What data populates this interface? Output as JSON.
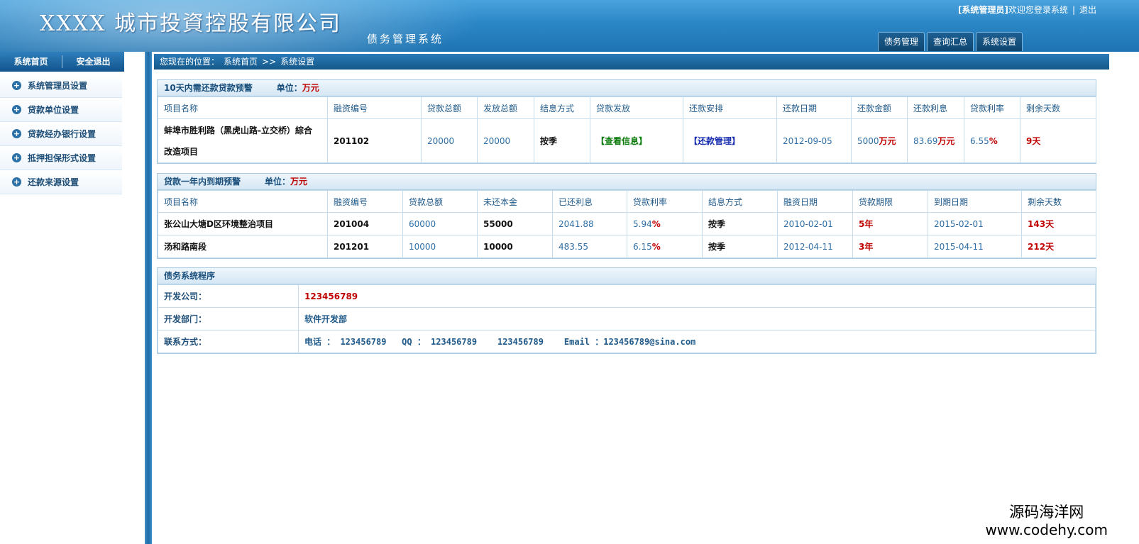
{
  "header": {
    "title": "XXXX 城市投資控股有限公司",
    "subtitle": "债务管理系统",
    "user_role": "[系统管理员]",
    "welcome": "欢迎您登录系统",
    "separator": "|",
    "logout": "退出",
    "tabs": [
      "债务管理",
      "查询汇总",
      "系统设置"
    ]
  },
  "sidebar": {
    "top_buttons": [
      "系统首页",
      "安全退出"
    ],
    "items": [
      {
        "label": "系统管理员设置",
        "icon": "plus-circle-icon"
      },
      {
        "label": "贷款单位设置",
        "icon": "plus-circle-icon"
      },
      {
        "label": "贷款经办银行设置",
        "icon": "plus-circle-icon"
      },
      {
        "label": "抵押担保形式设置",
        "icon": "plus-circle-icon"
      },
      {
        "label": "还款来源设置",
        "icon": "plus-circle-icon"
      }
    ]
  },
  "breadcrumb": {
    "prefix": "您现在的位置：",
    "home": "系统首页",
    "arrow": ">>",
    "current": "系统设置"
  },
  "panel1": {
    "title": "10天内需还款贷款预警",
    "unit_label": "单位：",
    "unit_value": "万元",
    "columns": [
      "项目名称",
      "融资编号",
      "贷款总额",
      "发放总额",
      "结息方式",
      "贷款发放",
      "还款安排",
      "还款日期",
      "还款金额",
      "还款利息",
      "贷款利率",
      "剩余天数"
    ],
    "rows": [
      {
        "name_line1": "蚌埠市胜利路（黑虎山路-立交桥）綜合",
        "name_line2": "改造项目",
        "code": "201102",
        "total": "20000",
        "issued": "20000",
        "interest_method": "按季",
        "issue_link": "【查看信息】",
        "repay_link": "【还款管理】",
        "repay_date": "2012-09-05",
        "repay_amount_num": "5000",
        "repay_amount_unit": "万元",
        "interest_num": "83.69",
        "interest_unit": "万元",
        "rate_num": "6.55",
        "rate_unit": "%",
        "days_num": "9",
        "days_unit": "天"
      }
    ]
  },
  "panel2": {
    "title": "贷款一年内到期预警",
    "unit_label": "单位：",
    "unit_value": "万元",
    "columns": [
      "项目名称",
      "融资编号",
      "贷款总额",
      "未还本金",
      "已还利息",
      "贷款利率",
      "结息方式",
      "融资日期",
      "贷款期限",
      "到期日期",
      "剩余天数"
    ],
    "rows": [
      {
        "name": "张公山大塘D区环境整治项目",
        "code": "201004",
        "total": "60000",
        "principal": "55000",
        "interest": "2041.88",
        "rate_num": "5.94",
        "rate_unit": "%",
        "method": "按季",
        "date": "2010-02-01",
        "term_num": "5",
        "term_unit": "年",
        "due": "2015-02-01",
        "days_num": "143",
        "days_unit": "天"
      },
      {
        "name": "汤和路南段",
        "code": "201201",
        "total": "10000",
        "principal": "10000",
        "interest": "483.55",
        "rate_num": "6.15",
        "rate_unit": "%",
        "method": "按季",
        "date": "2012-04-11",
        "term_num": "3",
        "term_unit": "年",
        "due": "2015-04-11",
        "days_num": "212",
        "days_unit": "天"
      }
    ]
  },
  "panel3": {
    "title": "债务系统程序",
    "rows": [
      {
        "label": "开发公司：",
        "value": "123456789"
      },
      {
        "label": "开发部门：",
        "value": "软件开发部"
      },
      {
        "label": "联系方式：",
        "value": "电话 ： 123456789   QQ ： 123456789    123456789    Email ：123456789@sina.com"
      }
    ]
  },
  "watermark": {
    "line1": "源码海洋网",
    "line2": "www.codehy.com"
  }
}
